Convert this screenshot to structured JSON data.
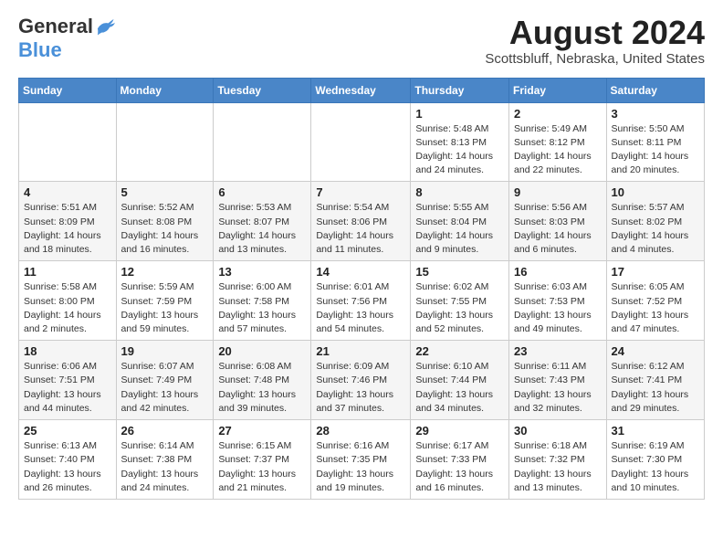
{
  "header": {
    "logo_general": "General",
    "logo_blue": "Blue",
    "month_title": "August 2024",
    "location": "Scottsbluff, Nebraska, United States"
  },
  "weekdays": [
    "Sunday",
    "Monday",
    "Tuesday",
    "Wednesday",
    "Thursday",
    "Friday",
    "Saturday"
  ],
  "weeks": [
    [
      {
        "day": "",
        "info": ""
      },
      {
        "day": "",
        "info": ""
      },
      {
        "day": "",
        "info": ""
      },
      {
        "day": "",
        "info": ""
      },
      {
        "day": "1",
        "info": "Sunrise: 5:48 AM\nSunset: 8:13 PM\nDaylight: 14 hours\nand 24 minutes."
      },
      {
        "day": "2",
        "info": "Sunrise: 5:49 AM\nSunset: 8:12 PM\nDaylight: 14 hours\nand 22 minutes."
      },
      {
        "day": "3",
        "info": "Sunrise: 5:50 AM\nSunset: 8:11 PM\nDaylight: 14 hours\nand 20 minutes."
      }
    ],
    [
      {
        "day": "4",
        "info": "Sunrise: 5:51 AM\nSunset: 8:09 PM\nDaylight: 14 hours\nand 18 minutes."
      },
      {
        "day": "5",
        "info": "Sunrise: 5:52 AM\nSunset: 8:08 PM\nDaylight: 14 hours\nand 16 minutes."
      },
      {
        "day": "6",
        "info": "Sunrise: 5:53 AM\nSunset: 8:07 PM\nDaylight: 14 hours\nand 13 minutes."
      },
      {
        "day": "7",
        "info": "Sunrise: 5:54 AM\nSunset: 8:06 PM\nDaylight: 14 hours\nand 11 minutes."
      },
      {
        "day": "8",
        "info": "Sunrise: 5:55 AM\nSunset: 8:04 PM\nDaylight: 14 hours\nand 9 minutes."
      },
      {
        "day": "9",
        "info": "Sunrise: 5:56 AM\nSunset: 8:03 PM\nDaylight: 14 hours\nand 6 minutes."
      },
      {
        "day": "10",
        "info": "Sunrise: 5:57 AM\nSunset: 8:02 PM\nDaylight: 14 hours\nand 4 minutes."
      }
    ],
    [
      {
        "day": "11",
        "info": "Sunrise: 5:58 AM\nSunset: 8:00 PM\nDaylight: 14 hours\nand 2 minutes."
      },
      {
        "day": "12",
        "info": "Sunrise: 5:59 AM\nSunset: 7:59 PM\nDaylight: 13 hours\nand 59 minutes."
      },
      {
        "day": "13",
        "info": "Sunrise: 6:00 AM\nSunset: 7:58 PM\nDaylight: 13 hours\nand 57 minutes."
      },
      {
        "day": "14",
        "info": "Sunrise: 6:01 AM\nSunset: 7:56 PM\nDaylight: 13 hours\nand 54 minutes."
      },
      {
        "day": "15",
        "info": "Sunrise: 6:02 AM\nSunset: 7:55 PM\nDaylight: 13 hours\nand 52 minutes."
      },
      {
        "day": "16",
        "info": "Sunrise: 6:03 AM\nSunset: 7:53 PM\nDaylight: 13 hours\nand 49 minutes."
      },
      {
        "day": "17",
        "info": "Sunrise: 6:05 AM\nSunset: 7:52 PM\nDaylight: 13 hours\nand 47 minutes."
      }
    ],
    [
      {
        "day": "18",
        "info": "Sunrise: 6:06 AM\nSunset: 7:51 PM\nDaylight: 13 hours\nand 44 minutes."
      },
      {
        "day": "19",
        "info": "Sunrise: 6:07 AM\nSunset: 7:49 PM\nDaylight: 13 hours\nand 42 minutes."
      },
      {
        "day": "20",
        "info": "Sunrise: 6:08 AM\nSunset: 7:48 PM\nDaylight: 13 hours\nand 39 minutes."
      },
      {
        "day": "21",
        "info": "Sunrise: 6:09 AM\nSunset: 7:46 PM\nDaylight: 13 hours\nand 37 minutes."
      },
      {
        "day": "22",
        "info": "Sunrise: 6:10 AM\nSunset: 7:44 PM\nDaylight: 13 hours\nand 34 minutes."
      },
      {
        "day": "23",
        "info": "Sunrise: 6:11 AM\nSunset: 7:43 PM\nDaylight: 13 hours\nand 32 minutes."
      },
      {
        "day": "24",
        "info": "Sunrise: 6:12 AM\nSunset: 7:41 PM\nDaylight: 13 hours\nand 29 minutes."
      }
    ],
    [
      {
        "day": "25",
        "info": "Sunrise: 6:13 AM\nSunset: 7:40 PM\nDaylight: 13 hours\nand 26 minutes."
      },
      {
        "day": "26",
        "info": "Sunrise: 6:14 AM\nSunset: 7:38 PM\nDaylight: 13 hours\nand 24 minutes."
      },
      {
        "day": "27",
        "info": "Sunrise: 6:15 AM\nSunset: 7:37 PM\nDaylight: 13 hours\nand 21 minutes."
      },
      {
        "day": "28",
        "info": "Sunrise: 6:16 AM\nSunset: 7:35 PM\nDaylight: 13 hours\nand 19 minutes."
      },
      {
        "day": "29",
        "info": "Sunrise: 6:17 AM\nSunset: 7:33 PM\nDaylight: 13 hours\nand 16 minutes."
      },
      {
        "day": "30",
        "info": "Sunrise: 6:18 AM\nSunset: 7:32 PM\nDaylight: 13 hours\nand 13 minutes."
      },
      {
        "day": "31",
        "info": "Sunrise: 6:19 AM\nSunset: 7:30 PM\nDaylight: 13 hours\nand 10 minutes."
      }
    ]
  ]
}
